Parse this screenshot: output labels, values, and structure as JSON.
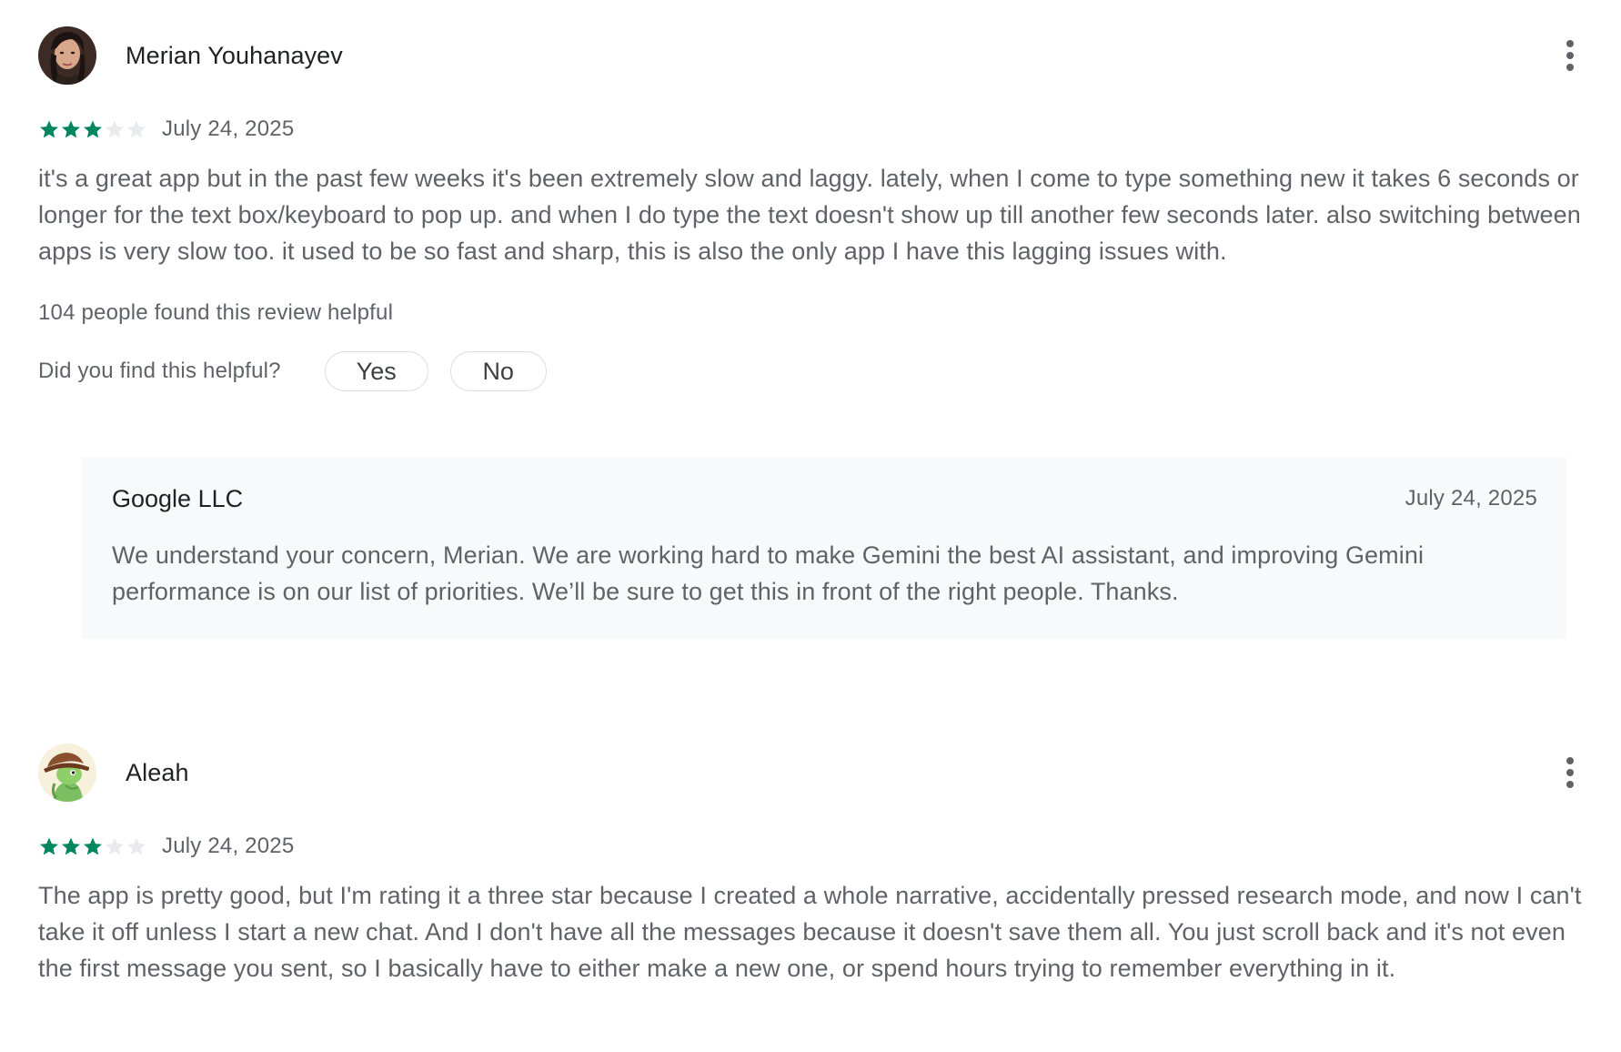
{
  "colors": {
    "star_filled": "#01875f",
    "star_empty": "#e8eaed",
    "text_primary": "#202124",
    "text_secondary": "#5f6368",
    "reply_background": "#f8f9fa"
  },
  "reviews": [
    {
      "author": "Merian Youhanayev",
      "rating": 3,
      "rating_max": 5,
      "date": "July 24, 2025",
      "text": "it's a great app but in the past few weeks it's been extremely slow and laggy. lately, when I come to type something new it takes 6 seconds or longer for the text box/keyboard to pop up. and when I do type the text doesn't show up till another few seconds later. also switching between apps is very slow too. it used to be so fast and sharp, this is also the only app I have this lagging issues with.",
      "helpful_count_text": "104 people found this review helpful",
      "helpful_question": "Did you find this helpful?",
      "yes_label": "Yes",
      "no_label": "No",
      "developer_reply": {
        "name": "Google LLC",
        "date": "July 24, 2025",
        "text": "We understand your concern, Merian. We are working hard to make Gemini the best AI assistant, and improving Gemini performance is on our list of priorities. We’ll be sure to get this in front of the right people. Thanks."
      }
    },
    {
      "author": "Aleah",
      "rating": 3,
      "rating_max": 5,
      "date": "July 24, 2025",
      "text": "The app is pretty good, but I'm rating it a three star because I created a whole narrative, accidentally pressed research mode, and now I can't take it off unless I start a new chat. And I don't have all the messages because it doesn't save them all. You just scroll back and it's not even the first message you sent, so I basically have to either make a new one, or spend hours trying to remember everything in it."
    }
  ],
  "icons": {
    "more": "more-vert-icon",
    "star": "star-icon"
  }
}
